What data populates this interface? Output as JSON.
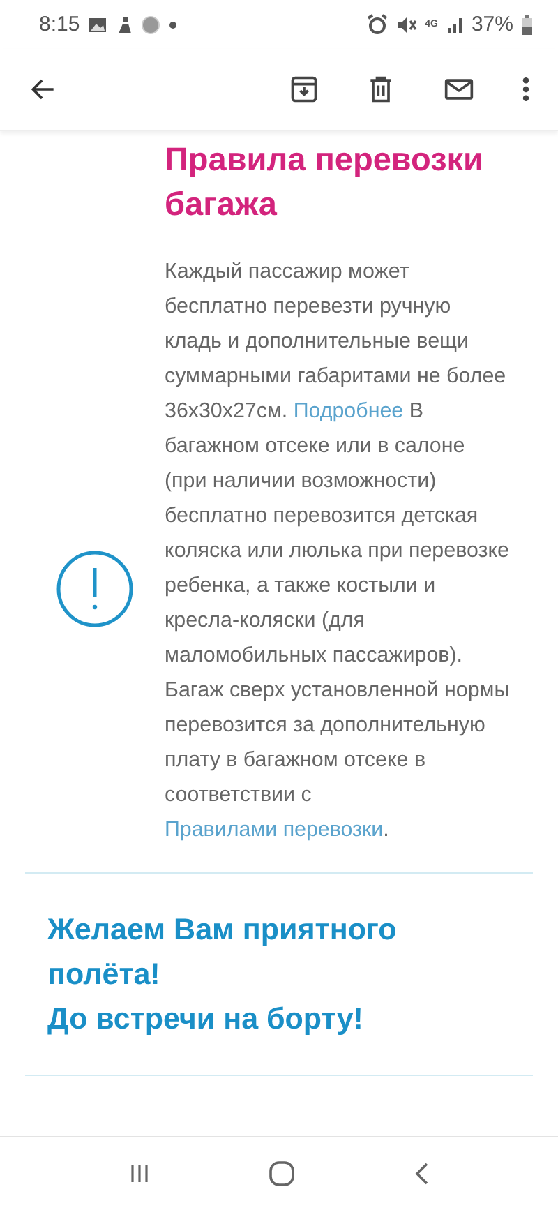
{
  "status_bar": {
    "time": "8:15",
    "network": "4G",
    "battery": "37%"
  },
  "article": {
    "title": "Правила перевозки багажа",
    "paragraph": [
      {
        "kind": "text",
        "text": "Каждый пассажир может бесплатно перевезти ручную кладь и дополнительные вещи суммарными габаритами не более 36х30х27см. "
      },
      {
        "kind": "link",
        "text": "Подробнее"
      },
      {
        "kind": "text",
        "text": " В багажном отсеке или в салоне (при наличии возможности) бесплатно перевозится детская коляска или люлька при перевозке ребенка, а также костыли и кресла-коляски (для маломобильных пассажиров). Багаж сверх установленной нормы перевозится за дополнительную плату в багажном отсеке в соответствии с "
      },
      {
        "kind": "link",
        "text": "Правилами перевозки"
      },
      {
        "kind": "text",
        "text": "."
      }
    ]
  },
  "greeting": [
    "Желаем Вам приятного полёта!",
    "До встречи на борту!"
  ]
}
